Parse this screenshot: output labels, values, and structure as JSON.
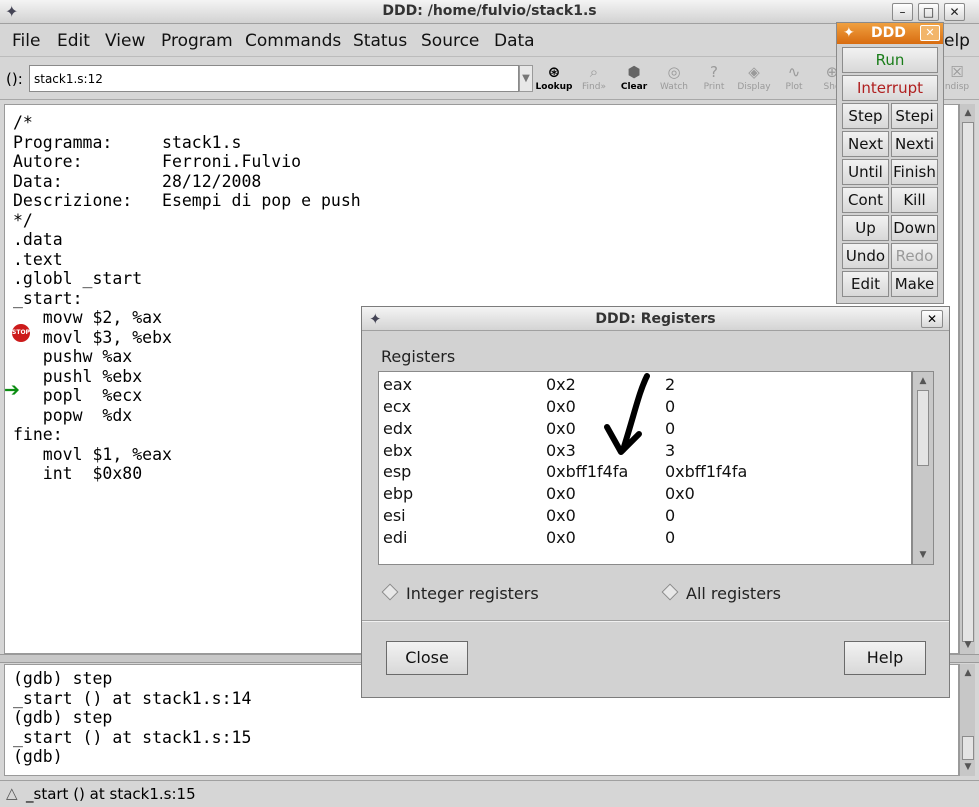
{
  "window": {
    "title": "DDD: /home/fulvio/stack1.s",
    "min_glyph": "–",
    "max_glyph": "□",
    "close_glyph": "✕"
  },
  "menu": [
    "File",
    "Edit",
    "View",
    "Program",
    "Commands",
    "Status",
    "Source",
    "Data"
  ],
  "toolbar": {
    "arg_label": "():",
    "arg_value": "stack1.s:12",
    "buttons": [
      {
        "label": "Lookup",
        "glyph": "⊛",
        "enabled": true
      },
      {
        "label": "Find»",
        "glyph": "⌕",
        "enabled": false
      },
      {
        "label": "Clear",
        "glyph": "⬢",
        "enabled": true
      },
      {
        "label": "Watch",
        "glyph": "◎",
        "enabled": false
      },
      {
        "label": "Print",
        "glyph": "?",
        "enabled": false
      },
      {
        "label": "Display",
        "glyph": "◈",
        "enabled": false
      },
      {
        "label": "Plot",
        "glyph": "∿",
        "enabled": false
      },
      {
        "label": "Sho",
        "glyph": "⊕",
        "enabled": false
      },
      {
        "label": "ndisp",
        "glyph": "☒",
        "enabled": false
      }
    ]
  },
  "source": {
    "lines": [
      "/*",
      "Programma:     stack1.s",
      "Autore:        Ferroni.Fulvio",
      "Data:          28/12/2008",
      "Descrizione:   Esempi di pop e push",
      "*/",
      ".data",
      ".text",
      ".globl _start",
      "_start:",
      "   movw $2, %ax",
      "   movl $3, %ebx",
      "   pushw %ax",
      "   pushl %ebx",
      "   popl  %ecx",
      "   popw  %dx",
      "fine:",
      "   movl $1, %eax",
      "   int  $0x80"
    ],
    "breakpoint_glyph": "STOP",
    "pc_glyph": "➔"
  },
  "console": {
    "lines": [
      "(gdb) step",
      "_start () at stack1.s:14",
      "(gdb) step",
      "_start () at stack1.s:15",
      "(gdb)"
    ]
  },
  "status": {
    "glyph": "△",
    "text": "_start () at stack1.s:15"
  },
  "command_tool": {
    "title": "DDD",
    "run": "Run",
    "interrupt": "Interrupt",
    "rows": [
      [
        "Step",
        "Stepi"
      ],
      [
        "Next",
        "Nexti"
      ],
      [
        "Until",
        "Finish"
      ],
      [
        "Cont",
        "Kill"
      ],
      [
        "Up",
        "Down"
      ],
      [
        "Undo",
        "Redo"
      ],
      [
        "Edit",
        "Make"
      ]
    ],
    "disabled": [
      "Redo"
    ],
    "run_color": "#1a7d1a",
    "interrupt_color": "#b02020"
  },
  "behind_menu_fragment": "elp",
  "registers": {
    "title": "DDD: Registers",
    "section_label": "Registers",
    "rows": [
      {
        "name": "eax",
        "hex": "0x2",
        "value": "2"
      },
      {
        "name": "ecx",
        "hex": "0x0",
        "value": "0"
      },
      {
        "name": "edx",
        "hex": "0x0",
        "value": "0"
      },
      {
        "name": "ebx",
        "hex": "0x3",
        "value": "3"
      },
      {
        "name": "esp",
        "hex": "0xbff1f4fa",
        "value": "0xbff1f4fa"
      },
      {
        "name": "ebp",
        "hex": "0x0",
        "value": "0x0"
      },
      {
        "name": "esi",
        "hex": "0x0",
        "value": "0"
      },
      {
        "name": "edi",
        "hex": "0x0",
        "value": "0"
      }
    ],
    "radio_integer": "Integer registers",
    "radio_all": "All registers",
    "close_button": "Close",
    "help_button": "Help"
  }
}
